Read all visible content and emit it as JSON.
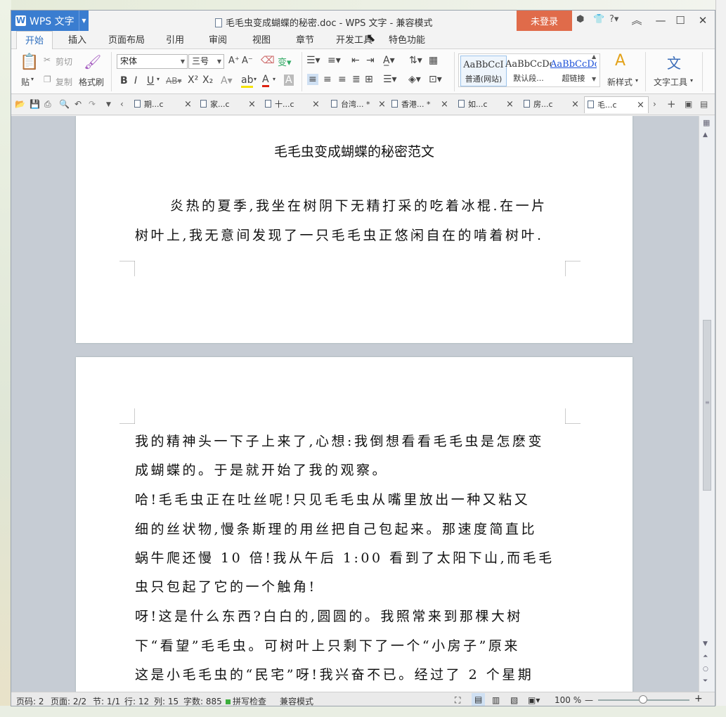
{
  "app": {
    "name": "WPS 文字",
    "window_title": "毛毛虫变成蝴蝶的秘密.doc - WPS 文字 - 兼容模式",
    "login": "未登录"
  },
  "menu": {
    "tabs": [
      "开始",
      "插入",
      "页面布局",
      "引用",
      "审阅",
      "视图",
      "章节",
      "开发工具",
      "特色功能"
    ]
  },
  "ribbon": {
    "paste": "贴",
    "cut": "剪切",
    "copy": "复制",
    "format_painter": "格式刷",
    "font_name": "宋体",
    "font_size": "三号",
    "styles": [
      {
        "preview": "AaBbCcI",
        "label": "普通(网站)"
      },
      {
        "preview": "AaBbCcDc",
        "label": "默认段..."
      },
      {
        "preview": "AaBbCcDc",
        "label": "超链接"
      }
    ],
    "new_style": "新样式",
    "text_tools": "文字工具"
  },
  "doc_tabs": [
    "期...c",
    "家...c",
    "十...c",
    "台湾... *",
    "香港... *",
    "如...c",
    "房...c",
    "毛...c"
  ],
  "document": {
    "title": "毛毛虫变成蝴蝶的秘密范文",
    "page1_lines": [
      "炎热的夏季,我坐在树阴下无精打采的吃着冰棍.在一片",
      "树叶上,我无意间发现了一只毛毛虫正悠闲自在的啃着树叶."
    ],
    "page2_lines": [
      "我的精神头一下子上来了,心想:我倒想看看毛毛虫是怎麽变",
      "成蝴蝶的。于是就开始了我的观察。",
      "哈!毛毛虫正在吐丝呢!只见毛毛虫从嘴里放出一种又粘又",
      "细的丝状物,慢条斯理的用丝把自己包起来。那速度简直比",
      "蜗牛爬还慢 10 倍!我从午后 1:00 看到了太阳下山,而毛毛",
      "虫只包起了它的一个触角!",
      "呀!这是什么东西?白白的,圆圆的。我照常来到那棵大树",
      "下“看望”毛毛虫。可树叶上只剩下了一个“小房子”原来",
      "这是小毛毛虫的“民宅”呀!我兴奋不已。经过了 2 个星期"
    ]
  },
  "status": {
    "page_code": "页码: 2",
    "pages": "页面: 2/2",
    "section": "节: 1/1",
    "line": "行: 12",
    "col": "列: 15",
    "word_count": "字数: 885",
    "spell": "拼写检查",
    "mode": "兼容模式",
    "zoom": "100 %"
  }
}
